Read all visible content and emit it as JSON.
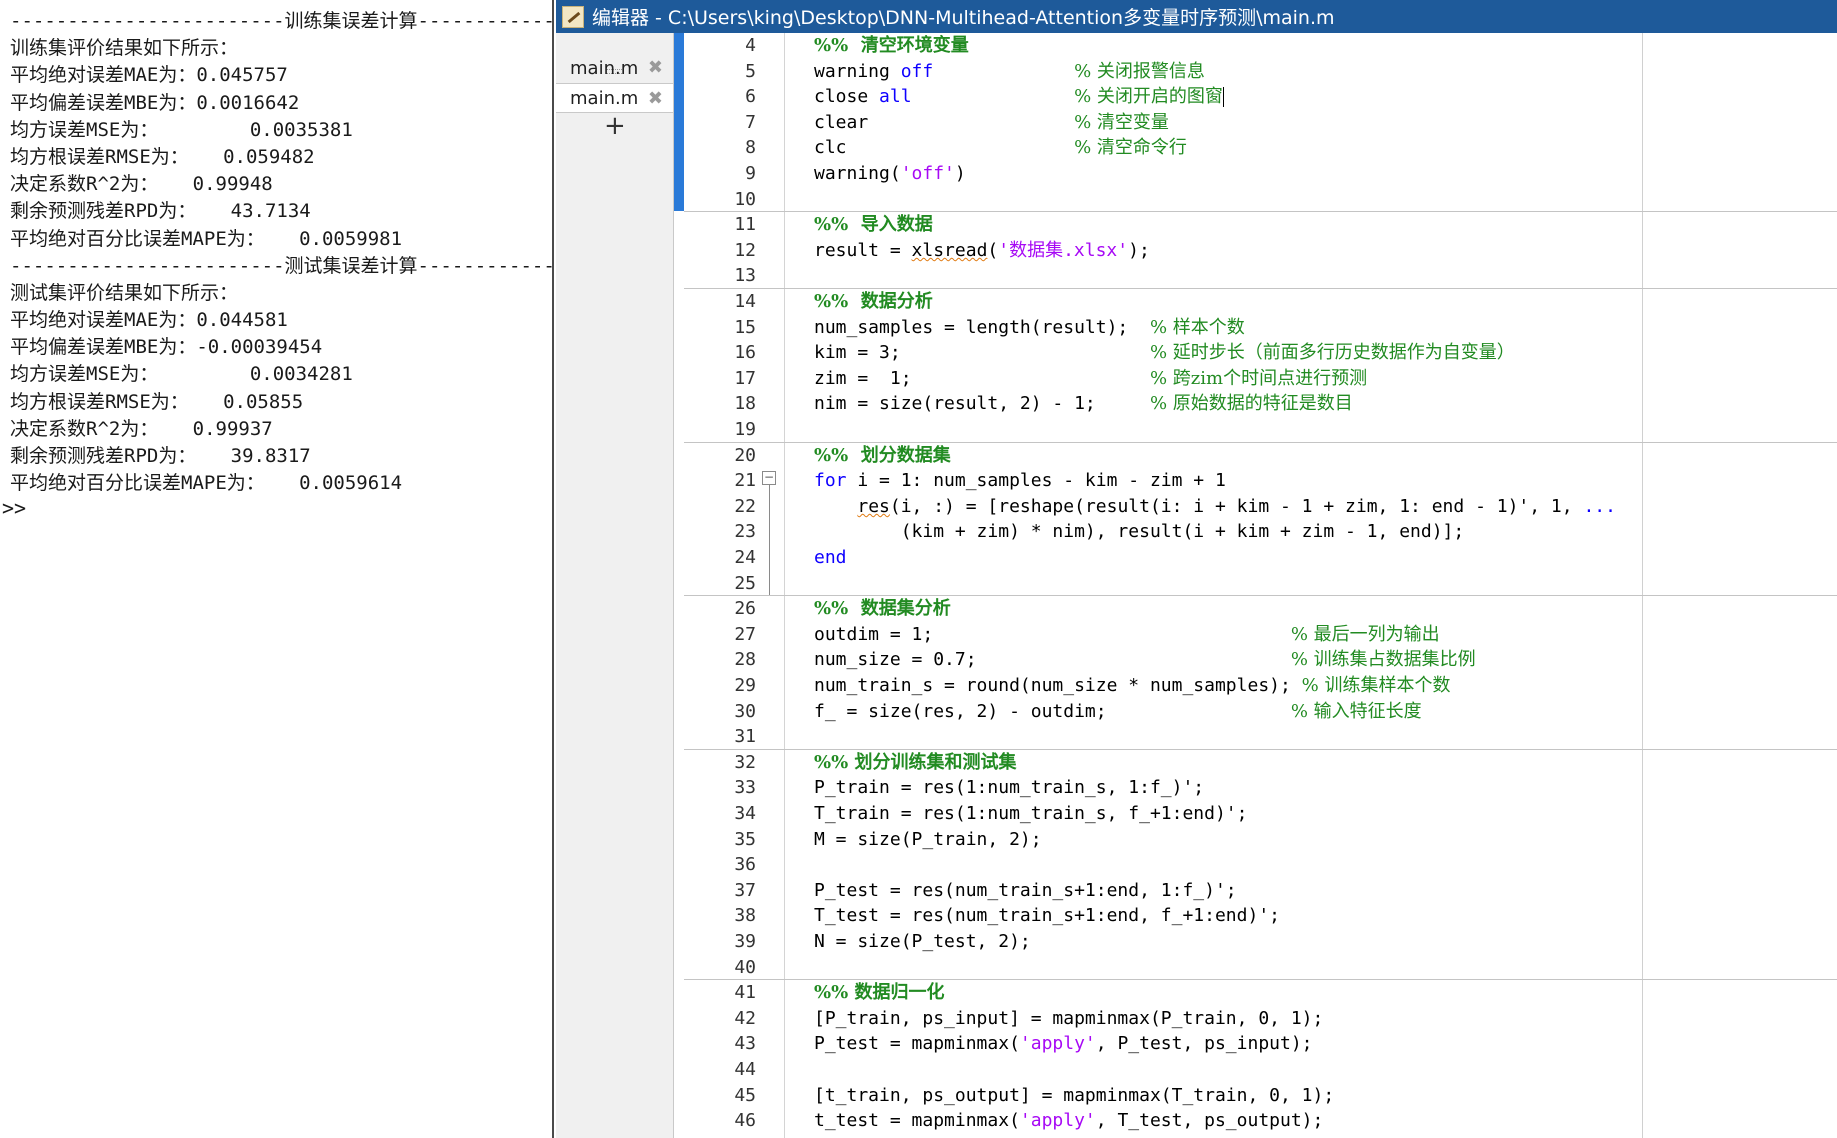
{
  "command_window": {
    "lines": [
      "------------------------训练集误差计算------------------------",
      "训练集评价结果如下所示：",
      "平均绝对误差MAE为：0.045757",
      "平均偏差误差MBE为：0.0016642",
      "均方误差MSE为：        0.0035381",
      "均方根误差RMSE为：   0.059482",
      "决定系数R^2为：   0.99948",
      "剩余预测残差RPD为：   43.7134",
      "平均绝对百分比误差MAPE为：   0.0059981",
      "------------------------测试集误差计算------------------------",
      "测试集评价结果如下所示：",
      "平均绝对误差MAE为：0.044581",
      "平均偏差误差MBE为：-0.00039454",
      "均方误差MSE为：        0.0034281",
      "均方根误差RMSE为：   0.05855",
      "决定系数R^2为：   0.99937",
      "剩余预测残差RPD为：   39.8317",
      "平均绝对百分比误差MAPE为：   0.0059614"
    ],
    "prompt": ">>"
  },
  "editor": {
    "title": "编辑器 - C:\\Users\\king\\Desktop\\DNN-Multihead-Attention多变量时序预测\\main.m",
    "tabs": [
      {
        "label": "main.m",
        "close": "✖"
      },
      {
        "label": "main.m",
        "close": "✖"
      }
    ],
    "add_tab": "+",
    "code": [
      {
        "n": "4",
        "t": [
          [
            "ch",
            "%%  清空环境变量"
          ]
        ]
      },
      {
        "n": "5",
        "t": [
          [
            "p",
            "warning "
          ],
          [
            "k",
            "off"
          ],
          [
            "p",
            "             "
          ],
          [
            "c",
            "% 关闭报警信息"
          ]
        ]
      },
      {
        "n": "6",
        "t": [
          [
            "p",
            "close "
          ],
          [
            "k",
            "all"
          ],
          [
            "p",
            "               "
          ],
          [
            "c",
            "% 关闭开启的图窗"
          ],
          [
            "cur",
            ""
          ]
        ]
      },
      {
        "n": "7",
        "t": [
          [
            "p",
            "clear                   "
          ],
          [
            "c",
            "% 清空变量"
          ]
        ]
      },
      {
        "n": "8",
        "t": [
          [
            "p",
            "clc                     "
          ],
          [
            "c",
            "% 清空命令行"
          ]
        ]
      },
      {
        "n": "9",
        "t": [
          [
            "p",
            "warning("
          ],
          [
            "s",
            "'off'"
          ],
          [
            "p",
            ")"
          ]
        ]
      },
      {
        "n": "10",
        "t": []
      },
      {
        "n": "11",
        "t": [
          [
            "ch",
            "%%  导入数据"
          ]
        ]
      },
      {
        "n": "12",
        "t": [
          [
            "p",
            "result = "
          ],
          [
            "q",
            "xlsread"
          ],
          [
            "p",
            "("
          ],
          [
            "s",
            "'数据集.xlsx'"
          ],
          [
            "p",
            ");"
          ]
        ]
      },
      {
        "n": "13",
        "t": []
      },
      {
        "n": "14",
        "t": [
          [
            "ch",
            "%%  数据分析"
          ]
        ]
      },
      {
        "n": "15",
        "t": [
          [
            "p",
            "num_samples = length(result);  "
          ],
          [
            "c",
            "% 样本个数"
          ]
        ]
      },
      {
        "n": "16",
        "t": [
          [
            "p",
            "kim = 3;                       "
          ],
          [
            "c",
            "% 延时步长（前面多行历史数据作为自变量）"
          ]
        ]
      },
      {
        "n": "17",
        "t": [
          [
            "p",
            "zim =  1;                      "
          ],
          [
            "c",
            "% 跨zim个时间点进行预测"
          ]
        ]
      },
      {
        "n": "18",
        "t": [
          [
            "p",
            "nim = size(result, 2) - 1;     "
          ],
          [
            "c",
            "% 原始数据的特征是数目"
          ]
        ]
      },
      {
        "n": "19",
        "t": []
      },
      {
        "n": "20",
        "t": [
          [
            "ch",
            "%%  划分数据集"
          ]
        ]
      },
      {
        "n": "21",
        "t": [
          [
            "k",
            "for"
          ],
          [
            "p",
            " i = 1: num_samples - kim - zim + 1"
          ]
        ]
      },
      {
        "n": "22",
        "t": [
          [
            "p",
            "    "
          ],
          [
            "q",
            "res"
          ],
          [
            "p",
            "(i, :) = [reshape(result(i: i + kim - 1 + zim, 1: end - 1)', 1, "
          ],
          [
            "k",
            "..."
          ]
        ]
      },
      {
        "n": "23",
        "t": [
          [
            "p",
            "        (kim + zim) * nim), result(i + kim + zim - 1, end)];"
          ]
        ]
      },
      {
        "n": "24",
        "t": [
          [
            "k",
            "end"
          ]
        ]
      },
      {
        "n": "25",
        "t": []
      },
      {
        "n": "26",
        "t": [
          [
            "ch",
            "%%  数据集分析"
          ]
        ]
      },
      {
        "n": "27",
        "t": [
          [
            "p",
            "outdim = 1;                                 "
          ],
          [
            "c",
            "% 最后一列为输出"
          ]
        ]
      },
      {
        "n": "28",
        "t": [
          [
            "p",
            "num_size = 0.7;                             "
          ],
          [
            "c",
            "% 训练集占数据集比例"
          ]
        ]
      },
      {
        "n": "29",
        "t": [
          [
            "p",
            "num_train_s = round(num_size * num_samples); "
          ],
          [
            "c",
            "% 训练集样本个数"
          ]
        ]
      },
      {
        "n": "30",
        "t": [
          [
            "p",
            "f_ = size(res, 2) - outdim;                 "
          ],
          [
            "c",
            "% 输入特征长度"
          ]
        ]
      },
      {
        "n": "31",
        "t": []
      },
      {
        "n": "32",
        "t": [
          [
            "ch",
            "%% 划分训练集和测试集"
          ]
        ]
      },
      {
        "n": "33",
        "t": [
          [
            "p",
            "P_train = res(1:num_train_s, 1:f_)';"
          ]
        ]
      },
      {
        "n": "34",
        "t": [
          [
            "p",
            "T_train = res(1:num_train_s, f_+1:end)';"
          ]
        ]
      },
      {
        "n": "35",
        "t": [
          [
            "p",
            "M = size(P_train, 2);"
          ]
        ]
      },
      {
        "n": "36",
        "t": []
      },
      {
        "n": "37",
        "t": [
          [
            "p",
            "P_test = res(num_train_s+1:end, 1:f_)';"
          ]
        ]
      },
      {
        "n": "38",
        "t": [
          [
            "p",
            "T_test = res(num_train_s+1:end, f_+1:end)';"
          ]
        ]
      },
      {
        "n": "39",
        "t": [
          [
            "p",
            "N = size(P_test, 2);"
          ]
        ]
      },
      {
        "n": "40",
        "t": []
      },
      {
        "n": "41",
        "t": [
          [
            "ch",
            "%% 数据归一化"
          ]
        ]
      },
      {
        "n": "42",
        "t": [
          [
            "p",
            "[P_train, ps_input] = mapminmax(P_train, 0, 1);"
          ]
        ]
      },
      {
        "n": "43",
        "t": [
          [
            "p",
            "P_test = mapminmax("
          ],
          [
            "s",
            "'apply'"
          ],
          [
            "p",
            ", P_test, ps_input);"
          ]
        ]
      },
      {
        "n": "44",
        "t": []
      },
      {
        "n": "45",
        "t": [
          [
            "p",
            "[t_train, ps_output] = mapminmax(T_train, 0, 1);"
          ]
        ]
      },
      {
        "n": "46",
        "t": [
          [
            "p",
            "t_test = mapminmax("
          ],
          [
            "s",
            "'apply'"
          ],
          [
            "p",
            ", T_test, ps_output);"
          ]
        ]
      }
    ]
  }
}
